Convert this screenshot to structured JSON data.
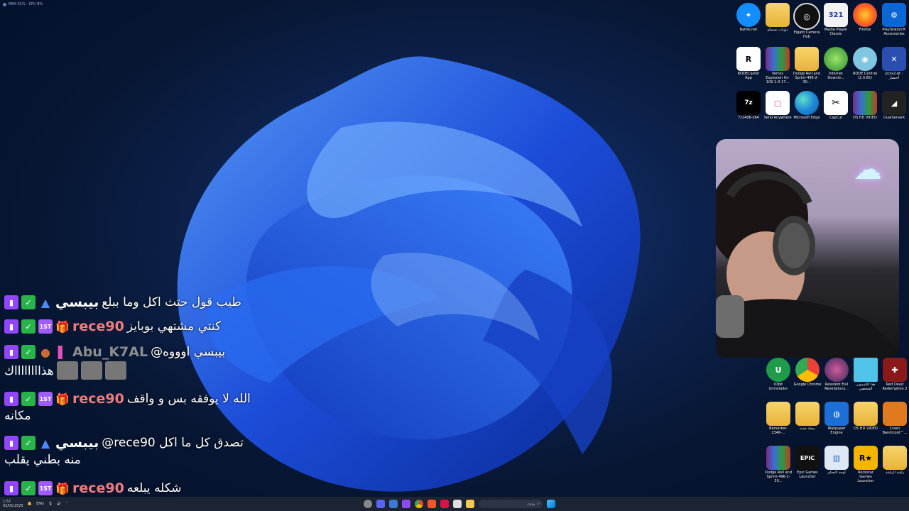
{
  "overlay_stats": "RAM 31% · CPU 8%",
  "desktop_icons_top": [
    {
      "label": "Battle.net"
    },
    {
      "label": "دورات نسمكو"
    },
    {
      "label": "Elgato Camera Hub"
    },
    {
      "label": "Media Player Classic"
    },
    {
      "label": "Firefox"
    },
    {
      "label": "PlayStation® Accessories"
    },
    {
      "label": "RODECaster App"
    },
    {
      "label": "Vertex Explosion fix-109-1-0-17..."
    },
    {
      "label": "Dodge Roll and Sprint-496-2-30..."
    },
    {
      "label": "Internet Downlo..."
    },
    {
      "label": "RODE Central (2.0.65)"
    },
    {
      "label": "pcsx2-qt - اختصار"
    },
    {
      "label": "7z2406-x64"
    },
    {
      "label": "Send Anywhere"
    },
    {
      "label": "Microsoft Edge"
    },
    {
      "label": "CapCut"
    },
    {
      "label": "DS HD VIDEO"
    },
    {
      "label": "DualSenseX"
    }
  ],
  "desktop_icons_bottom": [
    {
      "label": "IObit Uninstaller"
    },
    {
      "label": "Google Chrome"
    },
    {
      "label": "Resident Evil Revelations..."
    },
    {
      "label": "هذا الكمبيوتر الشخصي"
    },
    {
      "label": "Red Dead Redemption 2"
    },
    {
      "label": "Berserker-2346-..."
    },
    {
      "label": "مجلد جديد"
    },
    {
      "label": "Wallpaper Engine"
    },
    {
      "label": "DS HD VIDEO"
    },
    {
      "label": "Crash Bandicoot™..."
    },
    {
      "label": "Dodge Roll and Sprint-496-2-30..."
    },
    {
      "label": "Epic Games Launcher"
    },
    {
      "label": "لوحة التحكم"
    },
    {
      "label": "Rockstar Games Launcher"
    },
    {
      "label": "راشد الراشد"
    }
  ],
  "chat": [
    {
      "user": "بيبسي",
      "text": "طيب قول حتث اكل وما ببلع",
      "cont": ""
    },
    {
      "user": "rece90",
      "text": "كنتي مشتهي بوبايز",
      "cont": ""
    },
    {
      "user": "Abu_K7AL",
      "text": "@بيبسي اوووه",
      "cont": "هذااااااااك"
    },
    {
      "user": "rece90",
      "text": "الله لا يوفقه بس و واقف",
      "cont": "مكانه"
    },
    {
      "user": "بيبسي",
      "text": "@rece90 تصدق كل ما اكل",
      "cont": "منه بطني يقلب"
    },
    {
      "user": "rece90",
      "text": "شكله يبلعه",
      "cont": ""
    }
  ],
  "taskbar": {
    "lang": "ENG",
    "time": "1:57",
    "date": "02/01/2025",
    "search_placeholder": "بحث"
  }
}
